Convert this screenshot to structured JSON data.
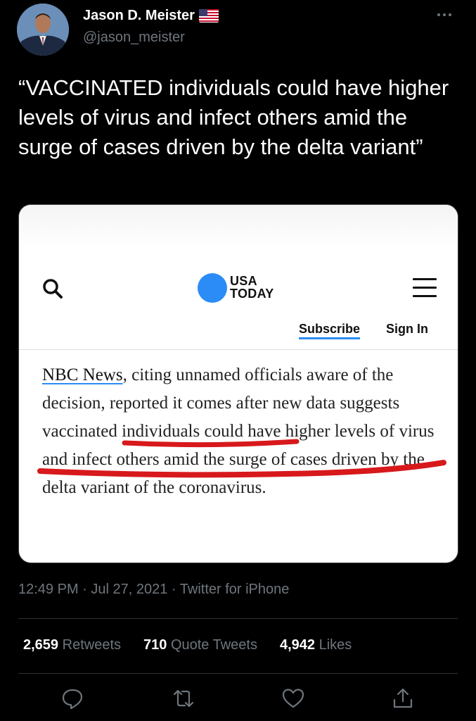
{
  "author": {
    "display_name": "Jason D. Meister",
    "handle": "@jason_meister",
    "badge_icon": "us-flag-icon"
  },
  "tweet": {
    "text": "“VACCINATED individuals could have higher levels of virus and infect others amid the surge of cases driven by the delta variant”",
    "timestamp": "12:49 PM · Jul 27, 2021 · Twitter for iPhone"
  },
  "image": {
    "site_logo_line1": "USA",
    "site_logo_line2": "TODAY",
    "subscribe_label": "Subscribe",
    "sign_in_label": "Sign In",
    "article_link": "NBC News",
    "article_body": ", citing unnamed officials aware of the decision, reported it comes after new data suggests vaccinated individuals could have higher levels of virus and infect others amid the surge of cases driven by the delta variant of the coronavirus.",
    "accent_color": "#2b8cf7",
    "highlight_color": "#d7191c"
  },
  "stats": {
    "retweets_count": "2,659",
    "retweets_label": "Retweets",
    "quotes_count": "710",
    "quotes_label": "Quote Tweets",
    "likes_count": "4,942",
    "likes_label": "Likes"
  },
  "actions": [
    "reply-icon",
    "retweet-icon",
    "like-icon",
    "share-icon"
  ]
}
